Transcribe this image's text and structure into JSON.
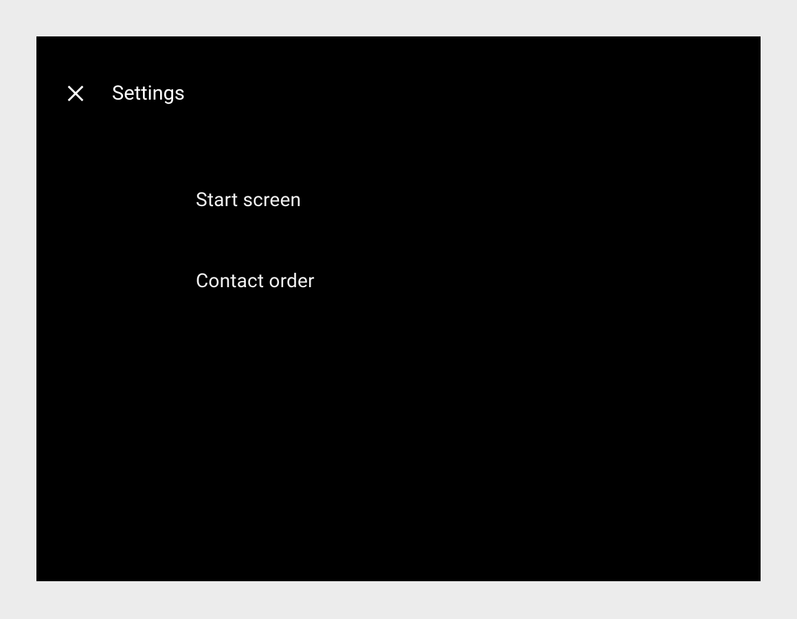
{
  "header": {
    "title": "Settings"
  },
  "items": [
    {
      "label": "Start screen"
    },
    {
      "label": "Contact order"
    }
  ]
}
